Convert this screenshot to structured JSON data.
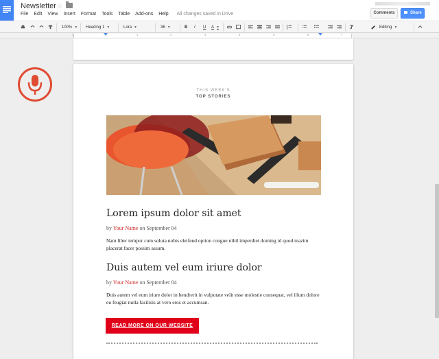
{
  "app": {
    "title": "Newsletter",
    "saved_status": "All changes saved in Drive",
    "menu": [
      "File",
      "Edit",
      "View",
      "Insert",
      "Format",
      "Tools",
      "Table",
      "Add-ons",
      "Help"
    ],
    "comments_label": "Comments",
    "share_label": "Share",
    "accent": "#4285f4"
  },
  "toolbar": {
    "zoom": "100%",
    "style": "Heading 1",
    "font": "Lora",
    "font_size": "36",
    "bold": "B",
    "italic": "I",
    "underline": "U",
    "text_color": "A",
    "mode": "Editing",
    "icons": [
      "print-icon",
      "undo-icon",
      "redo-icon",
      "paint-format-icon",
      "link-icon",
      "comment-icon",
      "align-left-icon",
      "align-center-icon",
      "align-right-icon",
      "justify-icon",
      "line-spacing-icon",
      "numbered-list-icon",
      "bulleted-list-icon",
      "decrease-indent-icon",
      "increase-indent-icon",
      "clear-formatting-icon",
      "pencil-icon",
      "collapse-icon"
    ]
  },
  "ruler": {
    "numbers": [
      "1",
      "1",
      "2",
      "3",
      "4",
      "5",
      "6",
      "7"
    ]
  },
  "document": {
    "kicker_line1": "THIS WEEK'S",
    "kicker_line2": "TOP STORIES",
    "articles": [
      {
        "title": "Lorem ipsum dolor sit amet",
        "by": "by",
        "author": "Your Name",
        "date": "on September 04",
        "body": "Nam liber tempor cum soluta nobis eleifend option congue nihil imperdiet doming id quod mazim placerat facer possim assum."
      },
      {
        "title": "Duis autem vel eum iriure dolor",
        "by": "by",
        "author": "Your Name",
        "date": "on September 04",
        "body": "Duis autem vel eum iriure dolor in hendrerit in vulputate velit esse molestie consequat, vel illum dolore eu feugiat nulla facilisis at vero eros et accumsan."
      }
    ],
    "cta": "READ MORE ON OUR WEBSITE",
    "cta_color": "#e0001a",
    "author_color": "#cc2222"
  },
  "voice": {
    "icon": "microphone-icon",
    "color": "#e04b33"
  }
}
